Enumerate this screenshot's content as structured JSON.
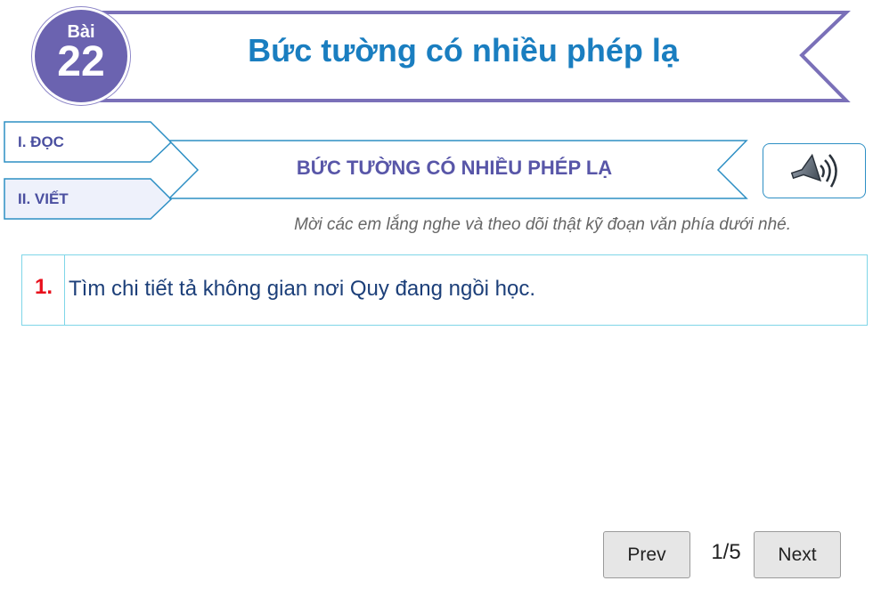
{
  "header": {
    "badge_prefix": "Bài",
    "badge_number": "22",
    "title": "Bức tường có nhiều phép lạ"
  },
  "tabs": [
    {
      "label": "I. ĐỌC",
      "active": false
    },
    {
      "label": "II. VIẾT",
      "active": true
    }
  ],
  "section": {
    "title": "BỨC TƯỜNG CÓ NHIỀU PHÉP LẠ"
  },
  "audio": {
    "icon": "speaker-icon"
  },
  "instruction": "Mời các em lắng nghe và theo dõi thật kỹ đoạn văn phía dưới nhé.",
  "question": {
    "number": "1.",
    "text": "Tìm chi tiết tả không gian nơi Quy đang ngồi học."
  },
  "pagination": {
    "prev_label": "Prev",
    "next_label": "Next",
    "page": "1/5"
  },
  "colors": {
    "accent_purple": "#6b63b0",
    "title_blue": "#1a7ec0",
    "question_red": "#e8101c",
    "border_cyan": "#7fd6e8"
  }
}
